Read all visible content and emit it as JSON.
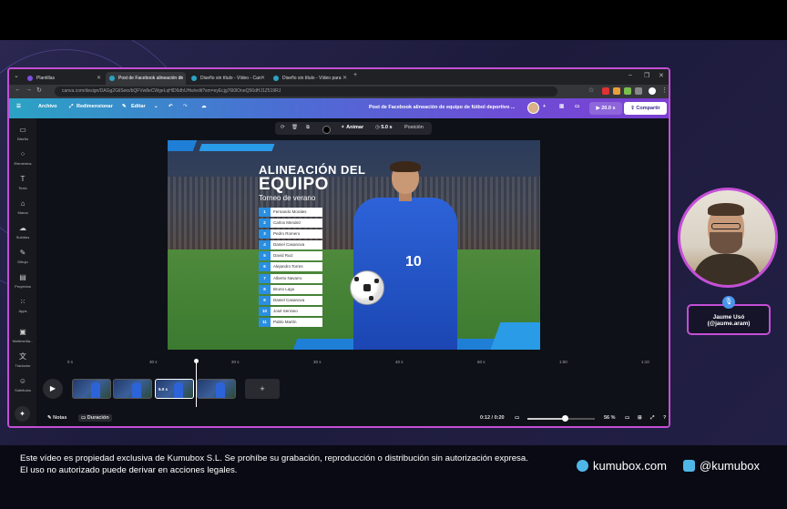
{
  "browser": {
    "tabs": [
      {
        "label": "Plantillas",
        "active": false
      },
      {
        "label": "Post de Facebook alineación de",
        "active": true
      },
      {
        "label": "Diseño sin título - Vídeo - Can",
        "active": false
      },
      {
        "label": "Diseño sin título - Vídeo para",
        "active": false
      }
    ],
    "new_tab": "+",
    "url": "canva.com/design/DAGg2GilSeio/bQFVw8eCWgeLqHlD6dhUHw/edit?sm=eyEcjg76l0lOneQ56dHJ1Z519RJ"
  },
  "canva_toolbar": {
    "file": "Archivo",
    "resize": "Redimensionar",
    "edit": "Editar",
    "design_title": "Post de Facebook alineación de equipo de fútbol deportivo ...",
    "play_duration": "20.0 s",
    "share": "Compartir"
  },
  "sidebar": [
    {
      "icon": "design-icon",
      "label": "Diseño"
    },
    {
      "icon": "elements-icon",
      "label": "Elementos"
    },
    {
      "icon": "text-icon",
      "label": "Texto"
    },
    {
      "icon": "brand-icon",
      "label": "Marca"
    },
    {
      "icon": "upload-icon",
      "label": "Subidos"
    },
    {
      "icon": "draw-icon",
      "label": "Dibujo"
    },
    {
      "icon": "projects-icon",
      "label": "Proyectos"
    },
    {
      "icon": "apps-icon",
      "label": "Apps"
    },
    {
      "icon": "multimedia-icon",
      "label": "Multimedia..."
    },
    {
      "icon": "translate-icon",
      "label": "Traductor"
    },
    {
      "icon": "subtitles-icon",
      "label": "Subtítulos"
    }
  ],
  "context_toolbar": {
    "animate": "Animar",
    "duration": "5.0 s",
    "position": "Posición"
  },
  "design": {
    "title_line1": "ALINEACIÓN DEL",
    "title_line2": "EQUIPO",
    "subtitle": "Torneo de verano",
    "jersey_number": "10",
    "roster": [
      {
        "num": "1",
        "name": "Fernando Morales"
      },
      {
        "num": "2",
        "name": "Carlos Mendez"
      },
      {
        "num": "3",
        "name": "Pedro Romero"
      },
      {
        "num": "4",
        "name": "Daniel Casanova"
      },
      {
        "num": "5",
        "name": "David Ruiz"
      },
      {
        "num": "6",
        "name": "Alejandro Torres"
      },
      {
        "num": "7",
        "name": "Alberto Navarro"
      },
      {
        "num": "8",
        "name": "Bruno Lago"
      },
      {
        "num": "9",
        "name": "Daniel Casanova"
      },
      {
        "num": "10",
        "name": "José Serrano"
      },
      {
        "num": "11",
        "name": "Pablo Martín"
      }
    ]
  },
  "timeline": {
    "ticks": [
      "0 s",
      "30 s",
      "20 s",
      "30 s",
      "40 s",
      "60 s",
      "1:00",
      "1:10"
    ],
    "selected_clip_label": "5.0 s",
    "add_clip": "+",
    "clip_count": 4
  },
  "bottom_bar": {
    "notes": "Notas",
    "duration": "Duración",
    "time": "0:12 / 0:20",
    "zoom": "56 %",
    "zoom_level": 0.56
  },
  "webcam": {
    "name": "Jaume Usó",
    "handle": "(@jaume.aram)"
  },
  "footer": {
    "disclaimer": "Este vídeo es propiedad exclusiva de Kumubox S.L. Se prohíbe su grabación, reproducción o distribución sin autorización expresa. El uso no autorizado puede derivar en acciones legales.",
    "website": "kumubox.com",
    "instagram": "@kumubox"
  },
  "colors": {
    "accent_border": "#c44fd6",
    "canva_gradient_start": "#2ba3c4",
    "canva_gradient_end": "#7b3fd1",
    "roster_blue": "#2a8fe0",
    "brand_cyan": "#4fb7e8"
  }
}
